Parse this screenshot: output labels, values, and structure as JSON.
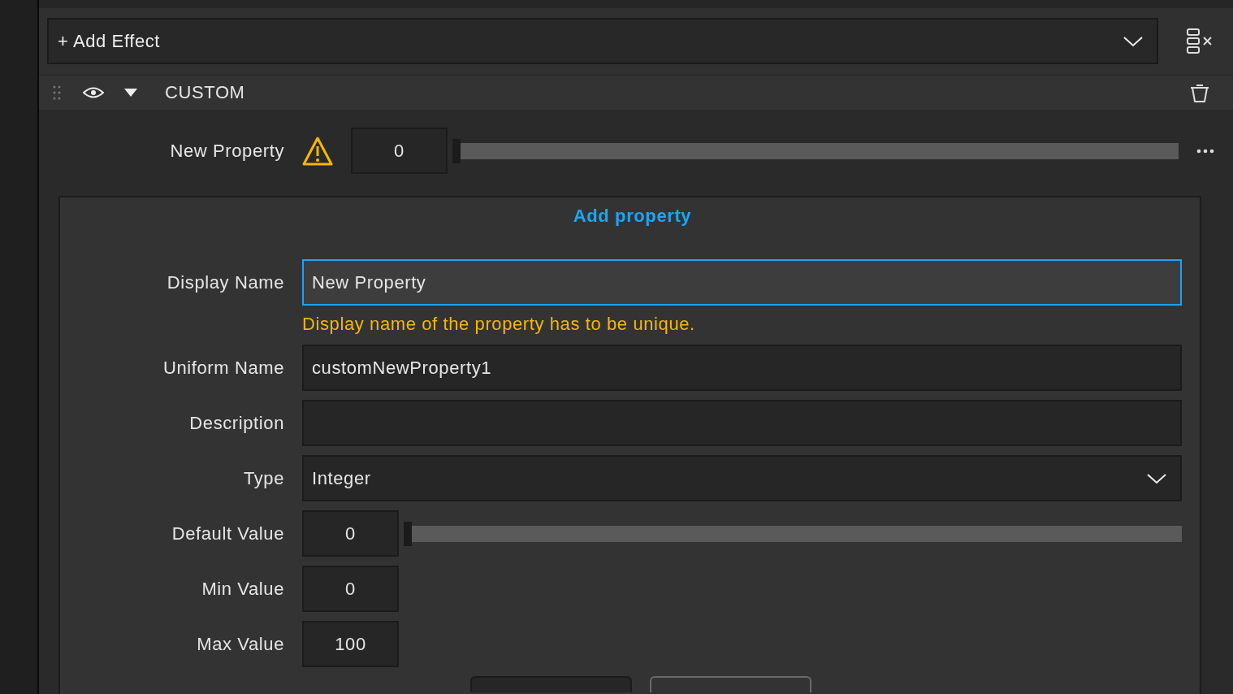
{
  "add_effect": {
    "label": "+ Add Effect"
  },
  "effect": {
    "title": "CUSTOM",
    "visible": true,
    "expanded": true,
    "properties": [
      {
        "name": "New Property",
        "warning": true,
        "value": "0",
        "level": 0
      }
    ]
  },
  "dialog": {
    "title": "Add property",
    "fields": [
      {
        "kind": "text",
        "label": "Display Name",
        "value": "New Property",
        "focused": true,
        "error": "Display name of the property has to be unique."
      },
      {
        "kind": "text",
        "label": "Uniform Name",
        "value": "customNewProperty1",
        "focused": false
      },
      {
        "kind": "text",
        "label": "Description",
        "focused": false
      },
      {
        "kind": "dropdown",
        "label": "Type",
        "value": "Integer"
      },
      {
        "kind": "slider",
        "label": "Default Value",
        "value": "0",
        "level": 0
      },
      {
        "kind": "number",
        "label": "Min Value",
        "value": "0"
      },
      {
        "kind": "number",
        "label": "Max Value",
        "value": "100"
      }
    ],
    "buttons": [
      {
        "kind": "primary"
      },
      {
        "kind": "secondary"
      }
    ]
  }
}
